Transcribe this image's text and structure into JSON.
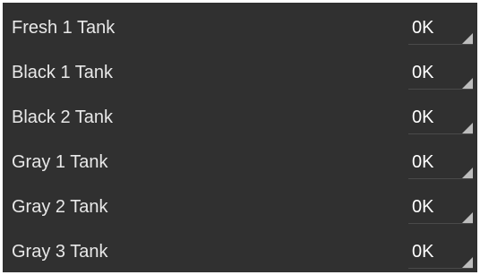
{
  "tanks": [
    {
      "label": "Fresh 1 Tank",
      "status": "0K"
    },
    {
      "label": "Black 1 Tank",
      "status": "0K"
    },
    {
      "label": "Black 2 Tank",
      "status": "0K"
    },
    {
      "label": "Gray 1 Tank",
      "status": "0K"
    },
    {
      "label": "Gray 2 Tank",
      "status": "0K"
    },
    {
      "label": "Gray 3 Tank",
      "status": "0K"
    }
  ],
  "colors": {
    "background": "#303030",
    "text": "#e8e8e8",
    "spinner_indicator": "#bdbdbd"
  },
  "icons": {
    "spinner_indicator": "spinner-corner-triangle-icon"
  }
}
